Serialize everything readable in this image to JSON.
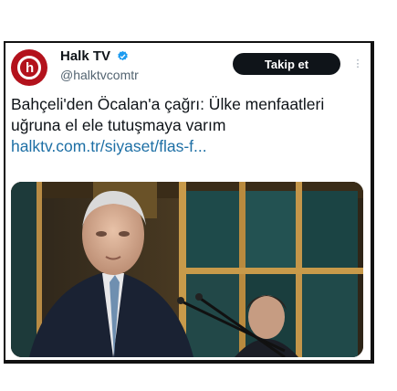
{
  "account": {
    "name": "Halk TV",
    "handle": "@halktvcomtr",
    "avatar_glyph": "h",
    "avatar_color": "#b3121c",
    "verified_color": "#1d9bf0"
  },
  "actions": {
    "follow_label": "Takip et",
    "more_icon": "more-icon"
  },
  "tweet": {
    "text_line": "Bahçeli'den Öcalan'a çağrı: Ülke menfaatleri uğruna el ele tutuşmaya varım",
    "link": "halktv.com.tr/siyaset/flas-f..."
  },
  "colors": {
    "text": "#0f1419",
    "muted": "#536471",
    "link": "#1d6fa5",
    "button": "#0f1419"
  }
}
